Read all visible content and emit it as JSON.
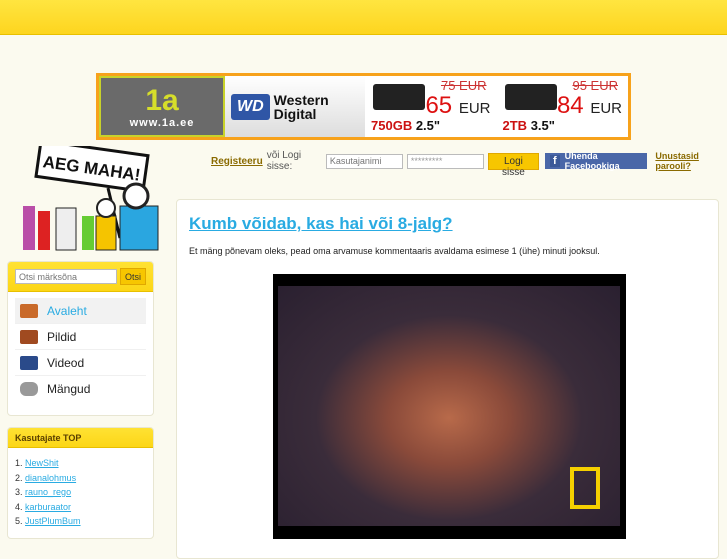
{
  "banner": {
    "brand": "1a",
    "url": "www.1a.ee",
    "wd_logo": "WD",
    "wd_name1": "Western",
    "wd_name2": "Digital",
    "products": [
      {
        "old_price": "75 EUR",
        "price": "65",
        "currency": "EUR",
        "capacity": "750",
        "unit": "GB",
        "size": "2.5\""
      },
      {
        "old_price": "95 EUR",
        "price": "84",
        "currency": "EUR",
        "capacity": "2",
        "unit": "TB",
        "size": "3.5\""
      }
    ]
  },
  "logo": {
    "text": "AEG MAHA!"
  },
  "login": {
    "register": "Registeeru",
    "or_login": "või Logi sisse:",
    "username_placeholder": "Kasutajanimi",
    "password_value": "*********",
    "login_button": "Logi sisse",
    "facebook_icon": "f",
    "facebook_button": "Ühenda Facebookiga",
    "forgot": "Unustasid parooli?"
  },
  "search": {
    "placeholder": "Otsi märksõna",
    "button": "Otsi"
  },
  "nav": [
    {
      "label": "Avaleht",
      "icon": "home-icon"
    },
    {
      "label": "Pildid",
      "icon": "pictures-icon"
    },
    {
      "label": "Videod",
      "icon": "video-icon"
    },
    {
      "label": "Mängud",
      "icon": "gamepad-icon"
    }
  ],
  "top": {
    "title": "Kasutajate TOP",
    "items": [
      {
        "rank": "1.",
        "name": "NewShit"
      },
      {
        "rank": "2.",
        "name": "dianalohmus"
      },
      {
        "rank": "3.",
        "name": "rauno_rego"
      },
      {
        "rank": "4.",
        "name": "karburaator"
      },
      {
        "rank": "5.",
        "name": "JustPlumBum"
      }
    ]
  },
  "article": {
    "title": "Kumb võidab, kas hai või 8-jalg?",
    "description": "Et mäng põnevam oleks, pead oma arvamuse kommentaaris avaldama esimese 1 (ühe) minuti jooksul."
  }
}
